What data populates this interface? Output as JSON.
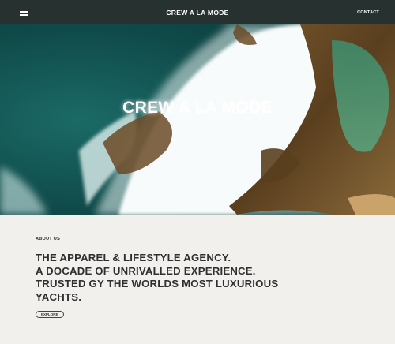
{
  "header": {
    "brand": "CREW A LA MODE",
    "contact_label": "CONTACT",
    "background": "#27312f"
  },
  "hero": {
    "title": "CREW A LA MODE",
    "image_description_icon": "aerial-coast-image"
  },
  "about": {
    "label": "ABOUT US",
    "headline_lines": [
      "THE APPAREL & LIFESTYLE AGENCY.",
      "A DOCADE OF UNRIVALLED EXPERIENCE.",
      "TRUSTED GY THE WORLDS MOST LUXURIOUS",
      "YACHTS."
    ],
    "explore_label": "EXPLORE",
    "background": "#f2f0ec"
  }
}
